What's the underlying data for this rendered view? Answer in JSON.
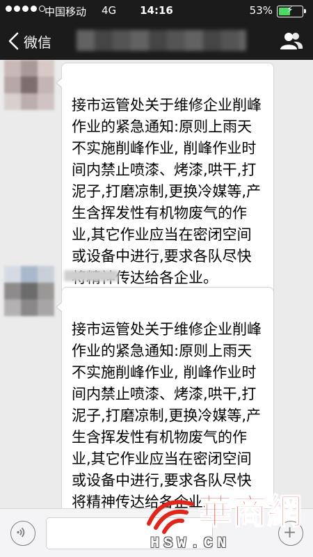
{
  "status_bar": {
    "carrier": "中国移动",
    "network": "4G",
    "time": "14:16",
    "battery_percent_label": "53%",
    "battery_level": 0.53
  },
  "nav": {
    "back_label": "微信",
    "back_icon": "chevron-left-icon",
    "contacts_icon": "contacts-icon"
  },
  "messages": [
    {
      "text": "接市运管处关于维修企业削峰作业的紧急通知:原则上雨天不实施削峰作业, 削峰作业时间内禁止喷漆、烤漆,哄干,打泥子,打磨凉制,更换冷媒等,产生含挥发性有机物废气的作业,其它作业应当在密闭空间或设备中进行,要求各队尽快将精神传达给各企业。"
    },
    {
      "text": "接市运管处关于维修企业削峰作业的紧急通知:原则上雨天不实施削峰作业, 削峰作业时间内禁止喷漆、烤漆,哄干,打泥子,打磨凉制,更换冷媒等,产生含挥发性有机物废气的作业,其它作业应当在密闭空间或设备中进行,要求各队尽快将精神传达给各企业。"
    }
  ],
  "input_bar": {
    "voice_icon": "voice-icon",
    "plus_icon": "plus-icon"
  },
  "watermark": {
    "logo_text": "華商網",
    "url": "HSW.CN"
  },
  "colors": {
    "header_bg": "#1b1b1b",
    "chat_bg": "#ebebeb",
    "bubble_bg": "#ffffff",
    "battery_fill": "#4cd964",
    "watermark_red": "#e0251b"
  }
}
